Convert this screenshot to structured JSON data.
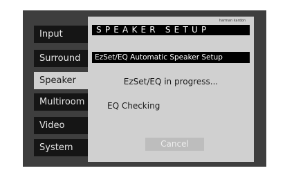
{
  "sidebar": {
    "items": [
      {
        "label": "Input"
      },
      {
        "label": "Surround"
      },
      {
        "label": "Speaker"
      },
      {
        "label": "Multiroom"
      },
      {
        "label": "Video"
      },
      {
        "label": "System"
      }
    ]
  },
  "dialog": {
    "brand": "harman kardon",
    "title": "SPEAKER SETUP",
    "subtitle": "EzSet/EQ Automatic Speaker Setup",
    "progress_text": "EzSet/EQ in progress...",
    "status_text": "EQ Checking",
    "cancel_label": "Cancel"
  },
  "colors": {
    "background": "#3e3e3e",
    "menu_item": "#151515",
    "active_item": "#d0d0d0",
    "dialog": "#d0d0d0",
    "title_bar": "#000000",
    "button": "#bdbdbd"
  }
}
